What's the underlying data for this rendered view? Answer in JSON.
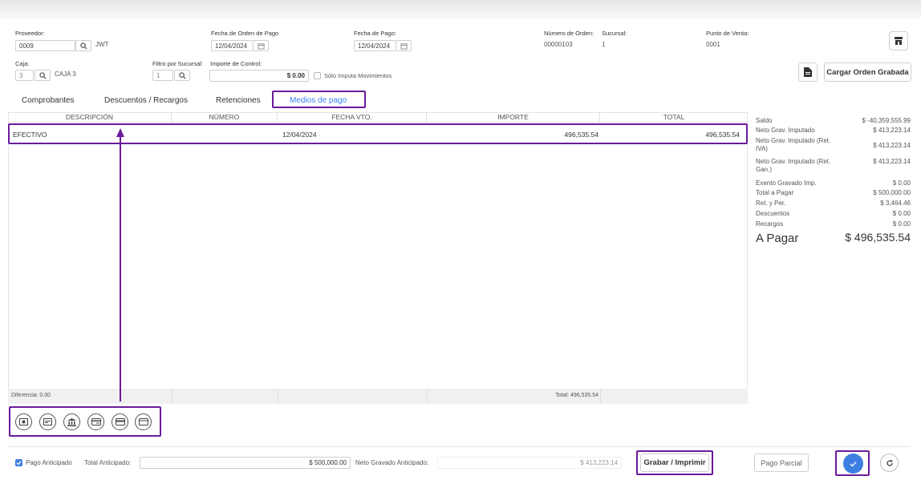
{
  "header": {
    "proveedor_label": "Proveedor:",
    "proveedor_code": "0009",
    "proveedor_name": "JWT",
    "fecha_orden_label": "Fecha de Orden de Pago",
    "fecha_orden_value": "12/04/2024",
    "fecha_pago_label": "Fecha de Pago:",
    "fecha_pago_value": "12/04/2024",
    "numero_orden_label": "Número de Orden:",
    "numero_orden_value": "00000103",
    "sucursal_label": "Sucursal:",
    "sucursal_value": "1",
    "punto_venta_label": "Punto de Venta:",
    "punto_venta_value": "0001",
    "caja_label": "Caja:",
    "caja_code": "3",
    "caja_name": "CAJA 3",
    "filtro_label": "Filtro por Sucursal:",
    "filtro_value": "1",
    "importe_control_label": "Importe de Control:",
    "importe_control_value": "$ 0.00",
    "solo_imputa_label": "Sólo Imputa Movimientos",
    "cargar_orden_label": "Cargar Orden Grabada"
  },
  "tabs": [
    {
      "label": "Comprobantes"
    },
    {
      "label": "Descuentos / Recargos"
    },
    {
      "label": "Retenciones"
    },
    {
      "label": "Medios de pago",
      "active": true
    }
  ],
  "table": {
    "columns": [
      "DESCRIPCIÓN",
      "NÚMERO",
      "FECHA VTO.",
      "IMPORTE",
      "TOTAL"
    ],
    "rows": [
      {
        "descripcion": "EFECTIVO",
        "numero": "",
        "fecha": "12/04/2024",
        "importe": "496,535.54",
        "total": "496,535.54"
      }
    ],
    "footer_diferencia": "Diferencia: 0.00",
    "footer_total": "Total: 496,535.54"
  },
  "summary": {
    "items": [
      {
        "label": "Saldo",
        "value": "$ -40,359,555.99"
      },
      {
        "label": "Neto Grav. Imputado",
        "value": "$ 413,223.14"
      },
      {
        "label": "Neto Grav. Imputado (Ret. IVA)",
        "value": "$ 413,223.14"
      },
      {
        "label": "Neto Grav. Imputado (Ret. Gan.)",
        "value": "$ 413,223.14"
      },
      {
        "label": "Exento Gravado Imp.",
        "value": "$ 0.00"
      },
      {
        "label": "Total a Pagar",
        "value": "$ 500,000.00"
      },
      {
        "label": "Ret. y Per.",
        "value": "$ 3,464.46"
      },
      {
        "label": "Descuentos",
        "value": "$ 0.00"
      },
      {
        "label": "Recargos",
        "value": "$ 0.00"
      }
    ],
    "a_pagar_label": "A Pagar",
    "a_pagar_value": "$ 496,535.54"
  },
  "payment_methods": [
    "cash-icon",
    "check-icon",
    "bank-icon",
    "transfer-icon",
    "credit-card-icon",
    "debit-card-icon"
  ],
  "bottom": {
    "pago_anticipado_label": "Pago Anticipado",
    "total_anticipado_label": "Total Anticipado:",
    "total_anticipado_value": "$ 500,000.00",
    "neto_gravado_label": "Neto Gravado Anticipado:",
    "neto_gravado_value": "$ 413,223.14",
    "grabar_label": "Grabar / Imprimir",
    "pago_parcial_label": "Pago Parcial"
  },
  "colors": {
    "accent": "#6a1b9a",
    "primary": "#3d7fe0",
    "active_tab": "#3b82f6"
  }
}
